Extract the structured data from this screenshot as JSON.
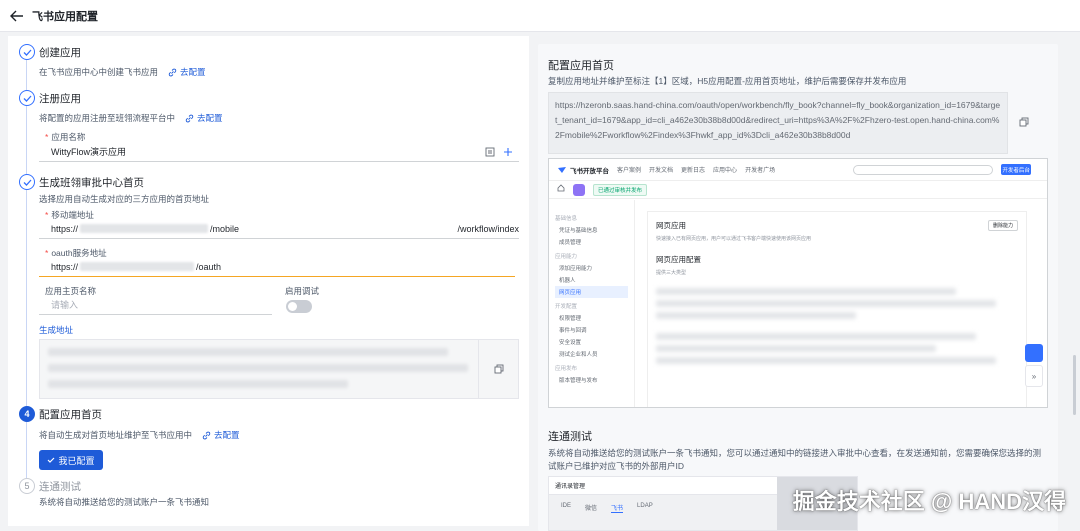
{
  "header": {
    "title": "飞书应用配置"
  },
  "steps": [
    {
      "title": "创建应用",
      "desc": "在飞书应用中心中创建飞书应用",
      "link": "去配置"
    },
    {
      "title": "注册应用",
      "desc": "将配置的应用注册至班翎流程平台中",
      "link": "去配置",
      "fields": {
        "app_name_label": "应用名称",
        "app_name_value": "WittyFlow演示应用"
      }
    },
    {
      "title": "生成班翎审批中心首页",
      "desc": "选择应用自动生成对应的三方应用的首页地址",
      "fields": {
        "mobile_label": "移动端地址",
        "mobile_prefix": "https://",
        "mobile_mid": "/mobile",
        "mobile_suffix": "/workflow/index",
        "oauth_label": "oauth服务地址",
        "oauth_prefix": "https://",
        "oauth_suffix": "/oauth",
        "home_name_label": "应用主页名称",
        "home_name_placeholder": "请输入",
        "debug_label": "启用调试",
        "gen_label": "生成地址"
      }
    },
    {
      "num": "4",
      "title": "配置应用首页",
      "desc": "将自动生成对首页地址维护至飞书应用中",
      "link": "去配置",
      "button": "我已配置"
    },
    {
      "num": "5",
      "title": "连通测试",
      "desc": "系统将自动推送给您的测试账户一条飞书通知"
    }
  ],
  "right": {
    "title": "配置应用首页",
    "desc": "复制应用地址并维护至标注【1】区域，H5应用配置-应用首页地址，维护后需要保存并发布应用",
    "url": "https://hzeronb.saas.hand-china.com/oauth/open/workbench/fly_book?channel=fly_book&organization_id=1679&target_tenant_id=1679&app_id=cli_a462e30b38b8d00d&redirect_uri=https%3A%2F%2Fhzero-test.open.hand-china.com%2Fmobile%2Fworkflow%2Findex%3Fhwkf_app_id%3Dcli_a462e30b38b8d00d",
    "test_title": "连通测试",
    "test_desc": "系统将自动推送给您的测试账户一条飞书通知，您可以通过通知中的链接进入审批中心查看，在发送通知前，您需要确保您选择的测试账户已维护对应飞书的外部用户ID"
  },
  "shot": {
    "logo": "飞书开放平台",
    "nav": [
      "客户案例",
      "开发文档",
      "更新日志",
      "应用中心",
      "开发者广场"
    ],
    "cta": "开发者后台",
    "status": "已通过审核并发布",
    "side_groups": [
      {
        "group": "基础信息",
        "items": [
          "凭证与基础信息",
          "成员管理"
        ]
      },
      {
        "group": "应用能力",
        "items": [
          "添加应用能力",
          "机器人",
          "网页应用"
        ]
      },
      {
        "group": "开发配置",
        "items": [
          "权限管理",
          "事件与回调",
          "安全设置",
          "测试企业和人员"
        ]
      },
      {
        "group": "应用发布",
        "items": [
          "版本管理与发布"
        ]
      }
    ],
    "main_title": "网页应用",
    "main_sub": "快速接入已有网页应用，用户可以通过飞书客户端快速使用该网页应用",
    "config_title": "网页应用配置",
    "config_sub": "提供三大类型",
    "view_btn": "删除能力"
  },
  "shot2": {
    "header": "通讯录管理",
    "tabs": [
      "IDE",
      "微信",
      "飞书",
      "LDAP"
    ]
  },
  "watermark": "掘金技术社区 @ HAND汉得"
}
